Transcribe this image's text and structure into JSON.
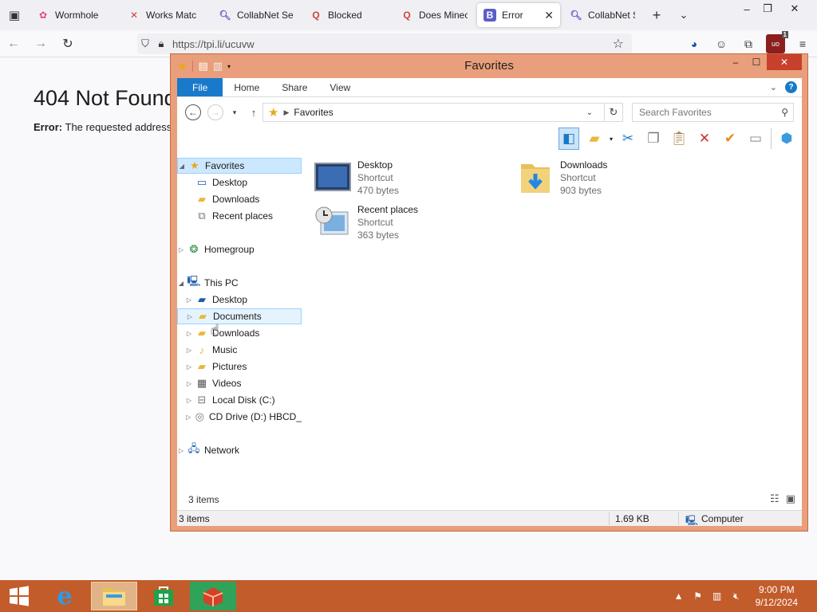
{
  "browser": {
    "tabs": [
      {
        "label": "Wormhole",
        "icon": "wormhole-icon",
        "color": "#e8477e"
      },
      {
        "label": "Works Matc",
        "icon": "works-icon",
        "color": "#d0453c"
      },
      {
        "label": "CollabNet Se",
        "icon": "search-tab-icon",
        "color": "#5b5fc7"
      },
      {
        "label": "Blocked",
        "icon": "q-tab-icon",
        "color": "#d0453c"
      },
      {
        "label": "Does Minec",
        "icon": "q-tab-icon",
        "color": "#d0453c"
      },
      {
        "label": "Error",
        "icon": "b-tab-icon",
        "color": "#5b5fc7",
        "active": true
      },
      {
        "label": "CollabNet Se",
        "icon": "search-tab-icon",
        "color": "#5b5fc7"
      }
    ],
    "url": "https://tpi.li/ucuvw",
    "ublock_badge": "1"
  },
  "page": {
    "title": "404 Not Found",
    "error_label": "Error:",
    "error_text": "The requested address"
  },
  "explorer": {
    "title": "Favorites",
    "ribbon_tabs": [
      "File",
      "Home",
      "Share",
      "View"
    ],
    "address": "Favorites",
    "search_placeholder": "Search Favorites",
    "nav": {
      "favorites": "Favorites",
      "fav_desktop": "Desktop",
      "fav_downloads": "Downloads",
      "fav_recent": "Recent places",
      "homegroup": "Homegroup",
      "this_pc": "This PC",
      "pc_desktop": "Desktop",
      "pc_documents": "Documents",
      "pc_downloads": "Downloads",
      "pc_music": "Music",
      "pc_pictures": "Pictures",
      "pc_videos": "Videos",
      "pc_local_disk": "Local Disk (C:)",
      "pc_cd_drive": "CD Drive (D:) HBCD_",
      "network": "Network"
    },
    "files": [
      {
        "name": "Desktop",
        "type": "Shortcut",
        "size": "470 bytes"
      },
      {
        "name": "Downloads",
        "type": "Shortcut",
        "size": "903 bytes"
      },
      {
        "name": "Recent places",
        "type": "Shortcut",
        "size": "363 bytes"
      }
    ],
    "item_count": "3 items",
    "status": {
      "items": "3 items",
      "size": "1.69 KB",
      "location": "Computer"
    }
  },
  "taskbar": {
    "time": "9:00 PM",
    "date": "9/12/2024"
  },
  "colors": {
    "explorer_frame": "#e99f7b",
    "taskbar": "#c25c2b",
    "close_button": "#c7402b",
    "file_tab": "#1979ca"
  }
}
